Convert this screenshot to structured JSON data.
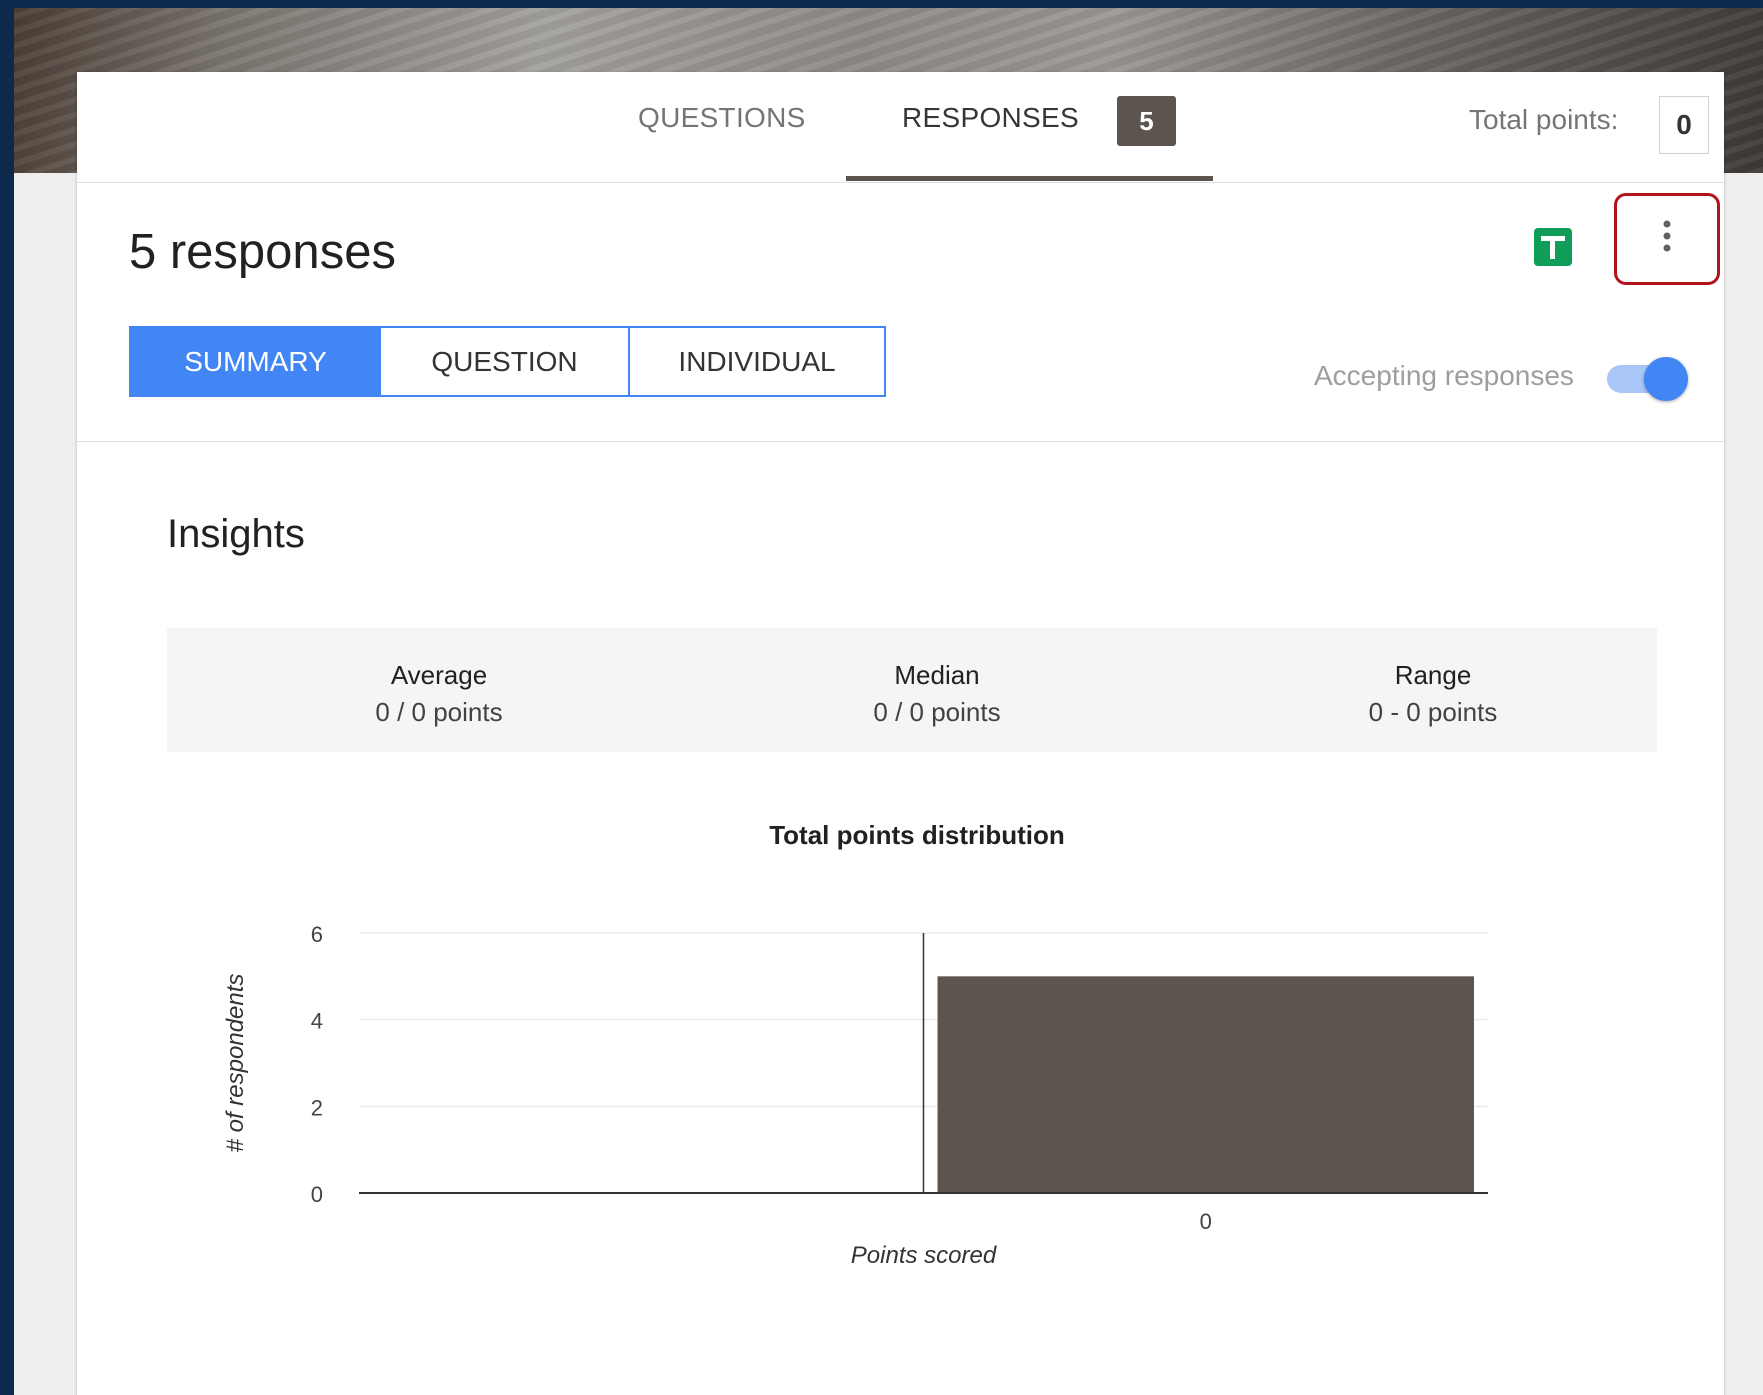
{
  "tabs": {
    "questions_label": "QUESTIONS",
    "responses_label": "RESPONSES",
    "responses_count": "5",
    "total_points_label": "Total points:",
    "total_points_value": "0"
  },
  "responses": {
    "title": "5 responses",
    "segments": [
      "SUMMARY",
      "QUESTION",
      "INDIVIDUAL"
    ],
    "accepting_label": "Accepting responses",
    "accepting_on": true
  },
  "insights": {
    "title": "Insights",
    "average_label": "Average",
    "average_value": "0 / 0 points",
    "median_label": "Median",
    "median_value": "0 / 0 points",
    "range_label": "Range",
    "range_value": "0 - 0 points"
  },
  "icons": {
    "sheets": "sheets-icon",
    "more": "more-vert-icon"
  },
  "colors": {
    "accent": "#4285f4",
    "bar": "#5d534f",
    "sheets_green": "#0f9d58",
    "highlight": "#b3121b"
  },
  "chart_data": {
    "type": "bar",
    "title": "Total points distribution",
    "xlabel": "Points scored",
    "ylabel": "# of respondents",
    "categories": [
      "0"
    ],
    "values": [
      5
    ],
    "ylim": [
      0,
      6
    ],
    "yticks": [
      0,
      2,
      4,
      6
    ],
    "grid": true
  }
}
